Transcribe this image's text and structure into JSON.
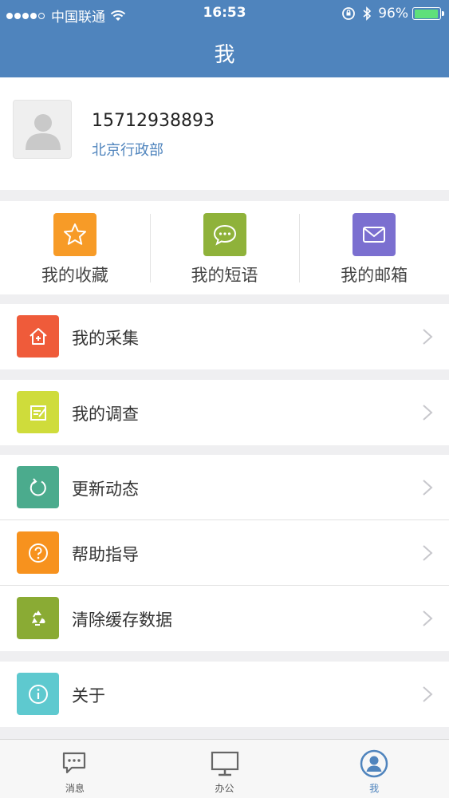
{
  "status_bar": {
    "carrier": "中国联通",
    "time": "16:53",
    "battery": "96%",
    "battery_level": 0.96
  },
  "nav": {
    "title": "我"
  },
  "profile": {
    "phone": "15712938893",
    "department": "北京行政部"
  },
  "quick_actions": [
    {
      "label": "我的收藏",
      "icon": "star-icon",
      "color": "#f79b27"
    },
    {
      "label": "我的短语",
      "icon": "chat-bubble-icon",
      "color": "#8fb23a"
    },
    {
      "label": "我的邮箱",
      "icon": "mail-icon",
      "color": "#7b6fd0"
    }
  ],
  "menu_groups": [
    [
      {
        "label": "我的采集",
        "icon": "house-plus-icon",
        "color": "#ef5b3a"
      }
    ],
    [
      {
        "label": "我的调查",
        "icon": "edit-note-icon",
        "color": "#cfdc3b"
      }
    ],
    [
      {
        "label": "更新动态",
        "icon": "refresh-icon",
        "color": "#4bab8d"
      },
      {
        "label": "帮助指导",
        "icon": "help-icon",
        "color": "#f7921e"
      },
      {
        "label": "清除缓存数据",
        "icon": "recycle-icon",
        "color": "#8aab34"
      }
    ],
    [
      {
        "label": "关于",
        "icon": "info-icon",
        "color": "#5ec9cf"
      }
    ]
  ],
  "tabs": [
    {
      "label": "消息",
      "icon": "message-icon"
    },
    {
      "label": "办公",
      "icon": "monitor-icon"
    },
    {
      "label": "我",
      "icon": "user-icon",
      "active": true
    }
  ],
  "colors": {
    "brand": "#4f84bd",
    "background": "#efeff1"
  }
}
